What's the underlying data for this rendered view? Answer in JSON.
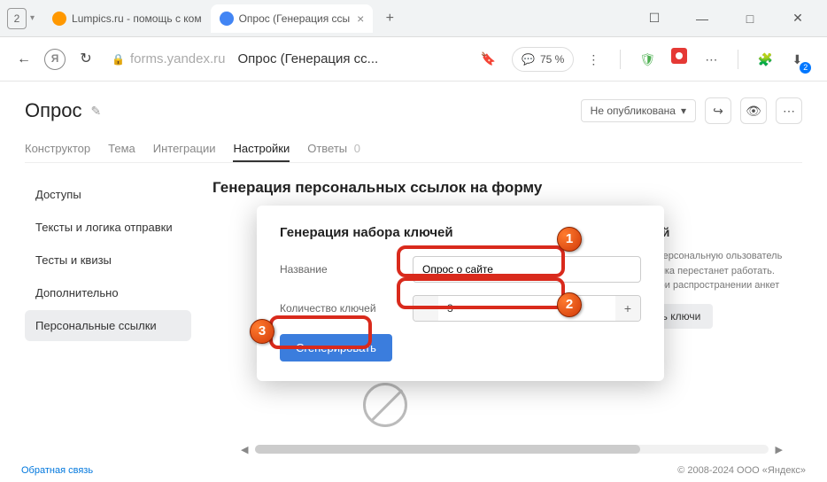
{
  "window": {
    "tab_count": "2"
  },
  "tabs": [
    {
      "label": "Lumpics.ru - помощь с ком"
    },
    {
      "label": "Опрос (Генерация ссы"
    }
  ],
  "addr": {
    "domain": "forms.yandex.ru",
    "title": "Опрос (Генерация сс...",
    "zoom": "75 %"
  },
  "app": {
    "title": "Опрос",
    "publish_status": "Не опубликована",
    "tabs": [
      "Конструктор",
      "Тема",
      "Интеграции",
      "Настройки",
      "Ответы"
    ],
    "answers_count": "0"
  },
  "sidebar": {
    "items": [
      "Доступы",
      "Тексты и логика отправки",
      "Тесты и квизы",
      "Дополнительно",
      "Персональные ссылки"
    ]
  },
  "main": {
    "title": "Генерация персональных ссылок на форму",
    "behind_title": "анных ключей",
    "behind_text": "о сгенерировать персональную ользователь заполняя эту ссылка перестанет работать. Такие апример, при распространении анкет",
    "behind_btn": "Сгенерировать ключи"
  },
  "modal": {
    "title": "Генерация набора ключей",
    "name_label": "Название",
    "name_value": "Опрос о сайте",
    "count_label": "Количество ключей",
    "count_value": "3",
    "generate": "Сгенерировать"
  },
  "footer": {
    "feedback": "Обратная связь",
    "copy": "© 2008-2024  ООО «Яндекс»"
  },
  "annot": {
    "n1": "1",
    "n2": "2",
    "n3": "3"
  }
}
